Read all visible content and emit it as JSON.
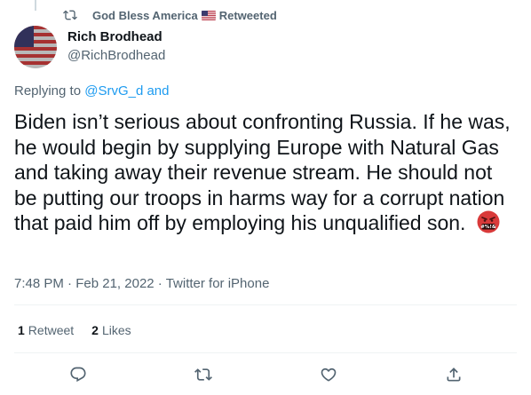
{
  "retweet_context": {
    "name": "God Bless America",
    "label": "Retweeted"
  },
  "author": {
    "name": "Rich Brodhead",
    "handle": "@RichBrodhead"
  },
  "replying": {
    "prefix": "Replying to ",
    "target": "@SrvG_d and"
  },
  "tweet": {
    "text": "Biden isn’t serious about confronting Russia.  If he was, he would begin by supplying Europe with Natural Gas and taking away their revenue stream. He should not be putting our troops in harms way for a corrupt nation that paid him off by employing his unqualified son."
  },
  "meta": {
    "time": "7:48 PM",
    "date": "Feb 21, 2022",
    "source": "Twitter for iPhone",
    "sep": " · "
  },
  "stats": {
    "retweets_count": "1",
    "retweets_label": "Retweet",
    "likes_count": "2",
    "likes_label": "Likes"
  },
  "colors": {
    "text": "#0f1419",
    "secondary": "#536471",
    "link": "#1d9bf0",
    "divider": "#eff3f4"
  },
  "icons": [
    "retweet-icon",
    "reply-icon",
    "like-icon",
    "share-icon",
    "angry-face-emoji"
  ]
}
